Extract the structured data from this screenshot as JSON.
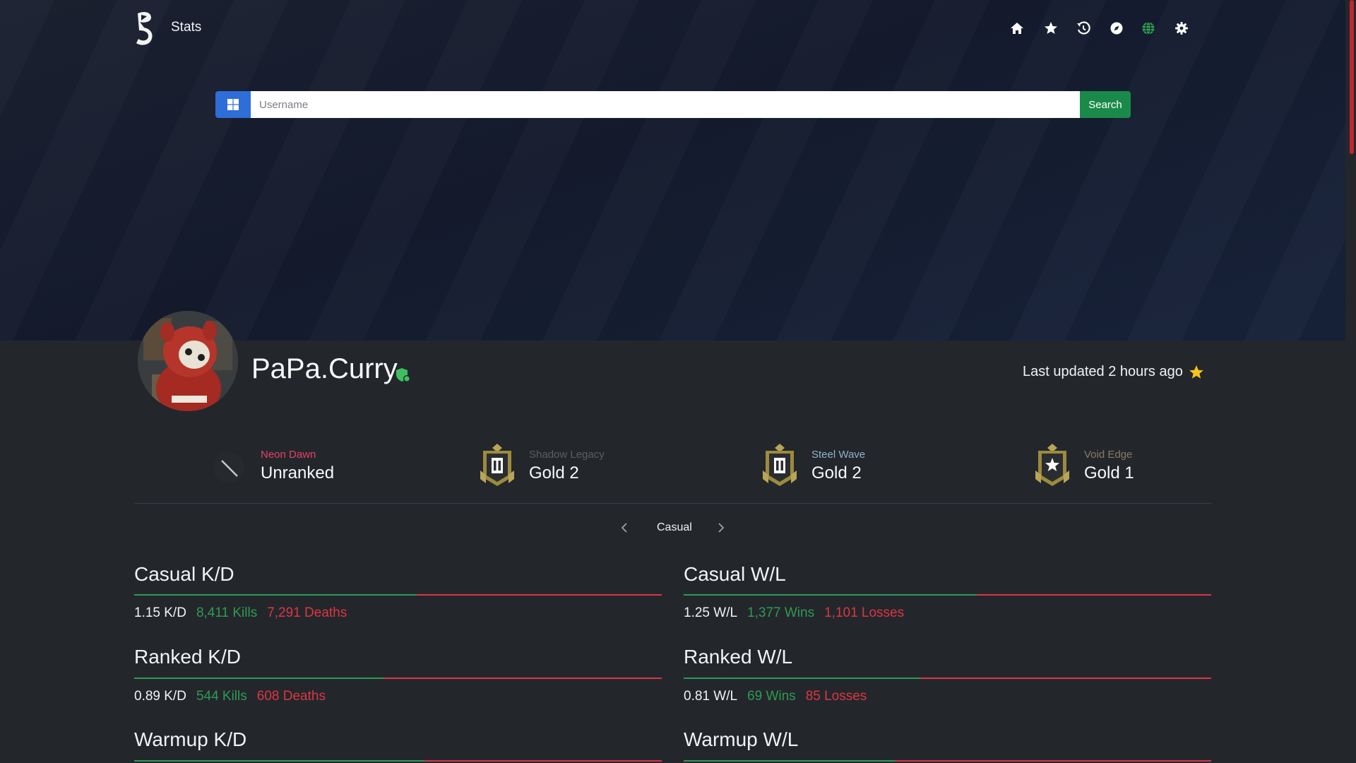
{
  "header": {
    "brand": "Stats",
    "nav": [
      {
        "icon": "home-icon"
      },
      {
        "icon": "star-icon"
      },
      {
        "icon": "history-icon"
      },
      {
        "icon": "compass-icon"
      },
      {
        "icon": "globe-icon"
      },
      {
        "icon": "gear-icon"
      }
    ]
  },
  "search": {
    "platform_icon": "windows-icon",
    "placeholder": "Username",
    "button_label": "Search"
  },
  "profile": {
    "username": "PaPa.Curry",
    "last_updated": "Last updated 2 hours ago"
  },
  "seasons": [
    {
      "name": "Neon Dawn",
      "rank": "Unranked",
      "name_color": "#e83e6c"
    },
    {
      "name": "Shadow Legacy",
      "rank": "Gold 2",
      "name_color": "#5b5f63"
    },
    {
      "name": "Steel Wave",
      "rank": "Gold 2",
      "name_color": "#8fb3c9"
    },
    {
      "name": "Void Edge",
      "rank": "Gold 1",
      "name_color": "#8a7a66"
    }
  ],
  "mode_selector": {
    "current": "Casual"
  },
  "stats": {
    "casual_kd": {
      "title": "Casual K/D",
      "ratio": "1.15 K/D",
      "pos": "8,411 Kills",
      "neg": "7,291 Deaths",
      "share": 0.536
    },
    "casual_wl": {
      "title": "Casual W/L",
      "ratio": "1.25 W/L",
      "pos": "1,377 Wins",
      "neg": "1,101 Losses",
      "share": 0.556
    },
    "ranked_kd": {
      "title": "Ranked K/D",
      "ratio": "0.89 K/D",
      "pos": "544 Kills",
      "neg": "608 Deaths",
      "share": 0.472
    },
    "ranked_wl": {
      "title": "Ranked W/L",
      "ratio": "0.81 W/L",
      "pos": "69 Wins",
      "neg": "85 Losses",
      "share": 0.448
    },
    "warmup_kd": {
      "title": "Warmup K/D",
      "share": 0.55
    },
    "warmup_wl": {
      "title": "Warmup W/L",
      "share": 0.4
    }
  },
  "colors": {
    "accent_green": "#1a8a4a",
    "kill_green": "#2e9a55",
    "death_red": "#dc3545",
    "platform_blue": "#2f6dd8",
    "favorite_yellow": "#f5c518"
  }
}
